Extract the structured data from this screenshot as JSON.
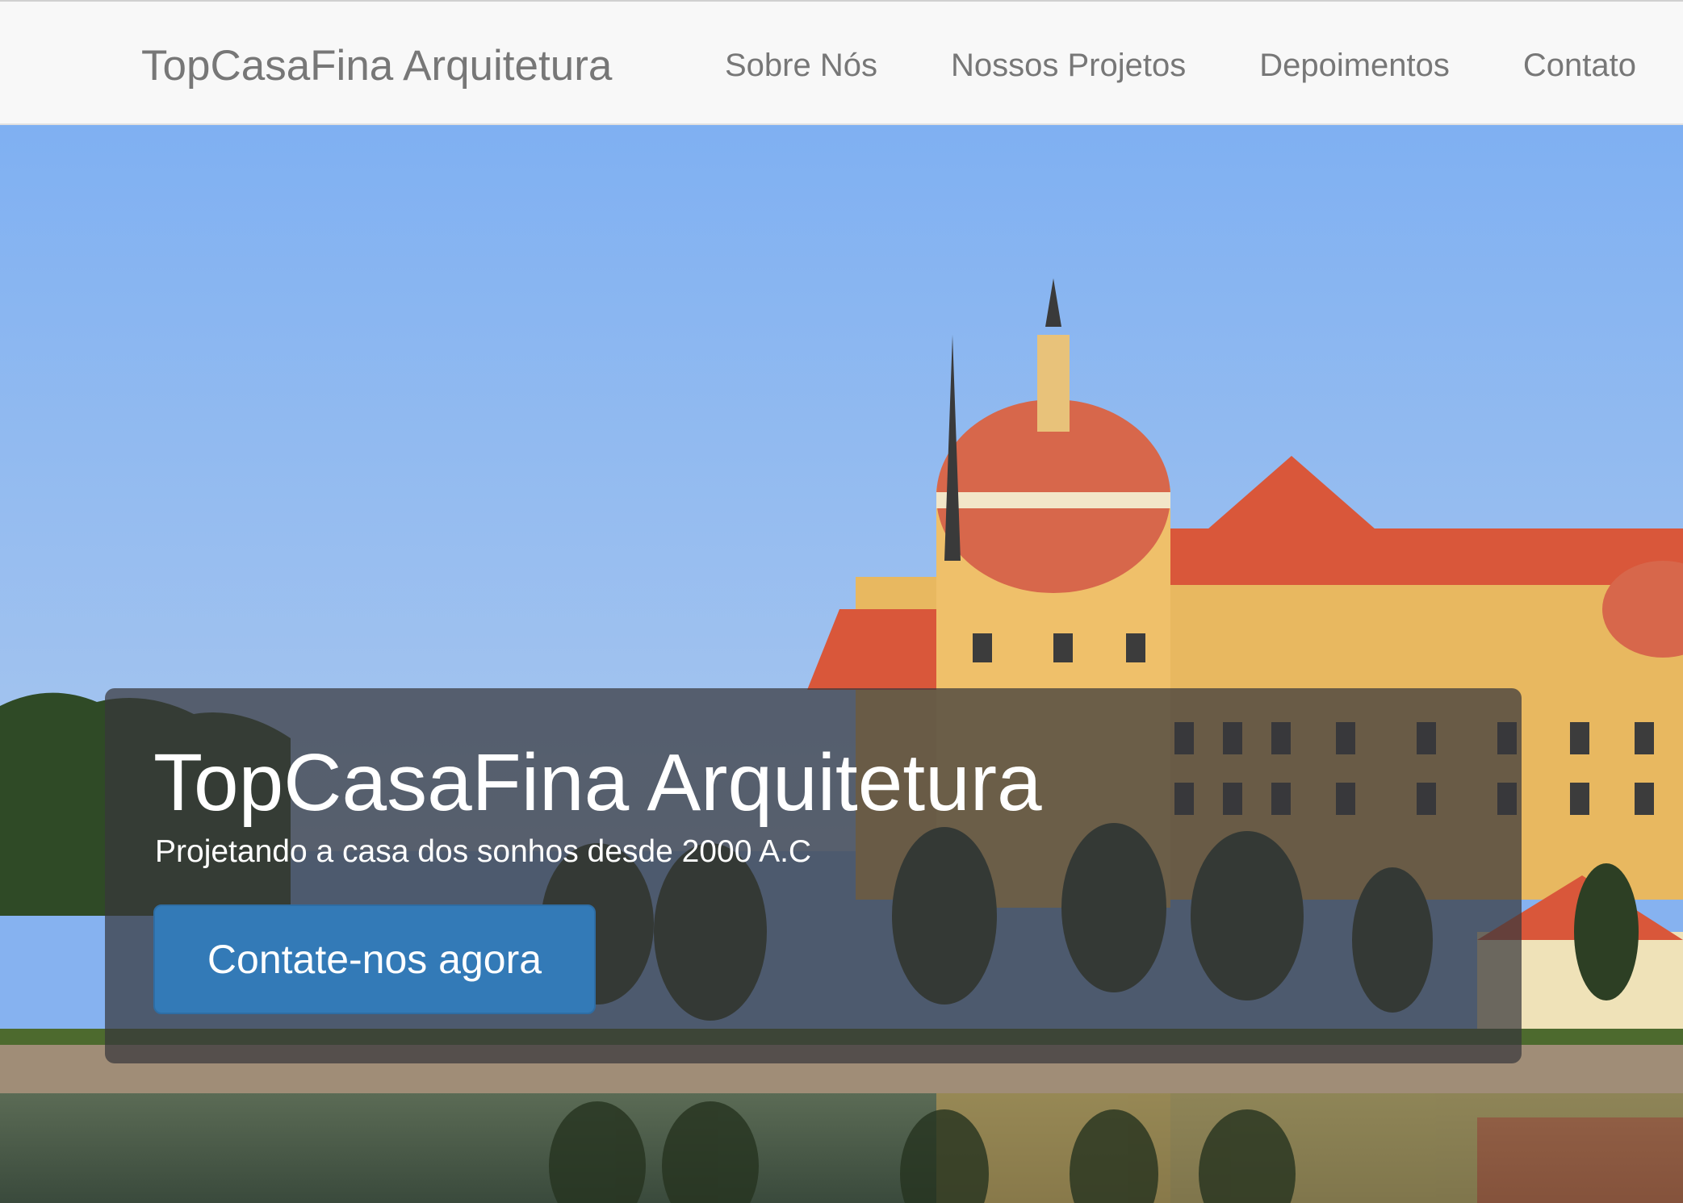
{
  "navbar": {
    "brand": "TopCasaFina Arquitetura",
    "links": [
      "Sobre Nós",
      "Nossos Projetos",
      "Depoimentos",
      "Contato"
    ]
  },
  "hero": {
    "image": "castle-by-lake-photo",
    "title": "TopCasaFina Arquitetura",
    "subtitle": "Projetando a casa dos sonhos desde 2000 A.C",
    "cta_label": "Contate-nos agora"
  },
  "colors": {
    "navbar_bg": "#f8f8f8",
    "nav_text": "#777777",
    "cta_bg": "#337ab7",
    "jumbotron_overlay": "rgba(55,55,60,0.72)"
  }
}
